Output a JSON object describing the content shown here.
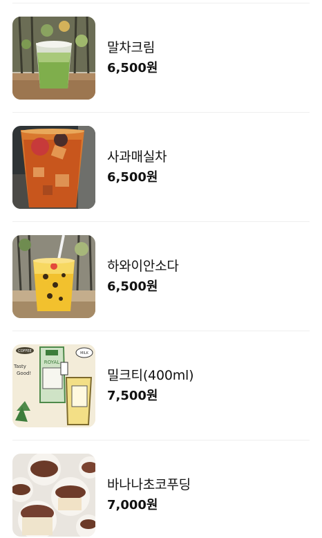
{
  "menu": {
    "items": [
      {
        "name": "말차크림",
        "price": "6,500원",
        "image": "matcha-cream-photo"
      },
      {
        "name": "사과매실차",
        "price": "6,500원",
        "image": "apple-plum-tea-photo"
      },
      {
        "name": "하와이안소다",
        "price": "6,500원",
        "image": "hawaiian-soda-photo"
      },
      {
        "name": "밀크티(400ml)",
        "price": "7,500원",
        "image": "milk-tea-photo"
      },
      {
        "name": "바나나초코푸딩",
        "price": "7,000원",
        "image": "banana-choco-pudding-photo"
      }
    ]
  },
  "package_text": {
    "badge": "COFFEE",
    "tasty": "Tasty",
    "good": "Good!",
    "royal": "ROYAL",
    "royal_milk": "ROYAL\nMILKTEA",
    "volume": "(400ml)",
    "rooibos": "ROOIBOS\nALMOND\nMILKTEA",
    "milk_bubble": "MILK"
  },
  "colors": {
    "divider": "#eeeeee",
    "text": "#111111"
  }
}
